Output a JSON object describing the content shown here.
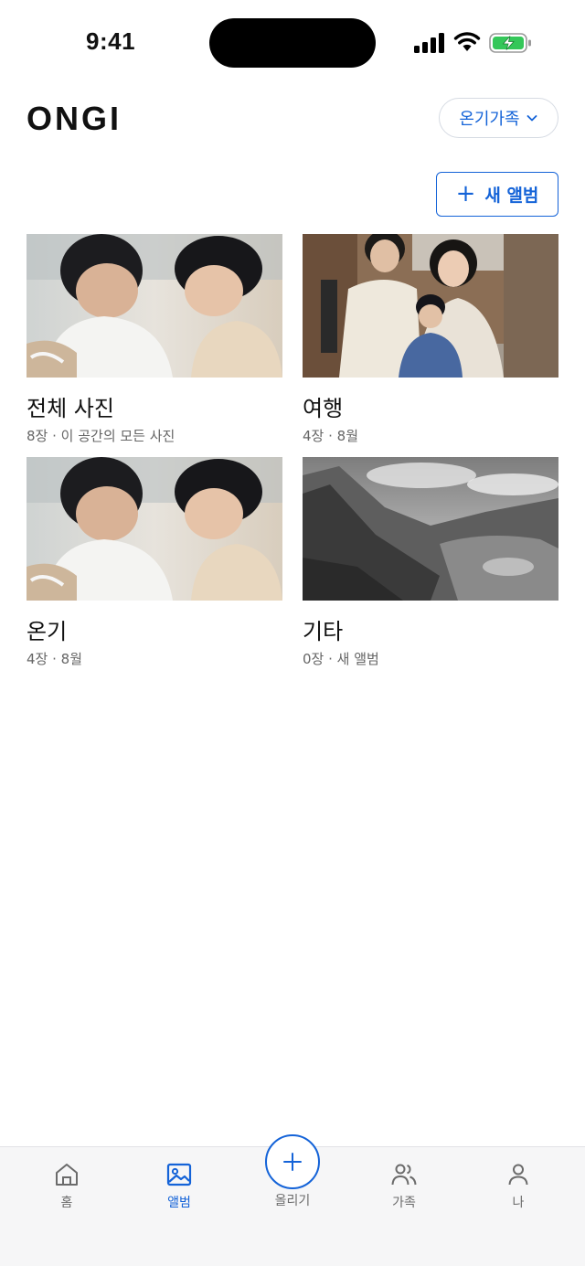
{
  "status": {
    "time": "9:41"
  },
  "header": {
    "logo": "ONGI",
    "family_select": "온기가족"
  },
  "actions": {
    "new_album_icon": "+",
    "new_album_label": "새 앨범"
  },
  "albums": [
    {
      "title": "전체 사진",
      "meta": "8장 · 이 공간의 모든 사진"
    },
    {
      "title": "여행",
      "meta": "4장 · 8월"
    },
    {
      "title": "온기",
      "meta": "4장 · 8월"
    },
    {
      "title": "기타",
      "meta": "0장 · 새 앨범"
    }
  ],
  "tabs": [
    {
      "label": "홈",
      "icon": "home-icon"
    },
    {
      "label": "앨범",
      "icon": "image-icon"
    },
    {
      "label": "올리기",
      "icon": "plus-icon"
    },
    {
      "label": "가족",
      "icon": "users-icon"
    },
    {
      "label": "나",
      "icon": "user-icon"
    }
  ],
  "colors": {
    "accent": "#1463d8",
    "text": "#111111",
    "muted": "#666666",
    "tab_bg": "#f6f6f7"
  }
}
